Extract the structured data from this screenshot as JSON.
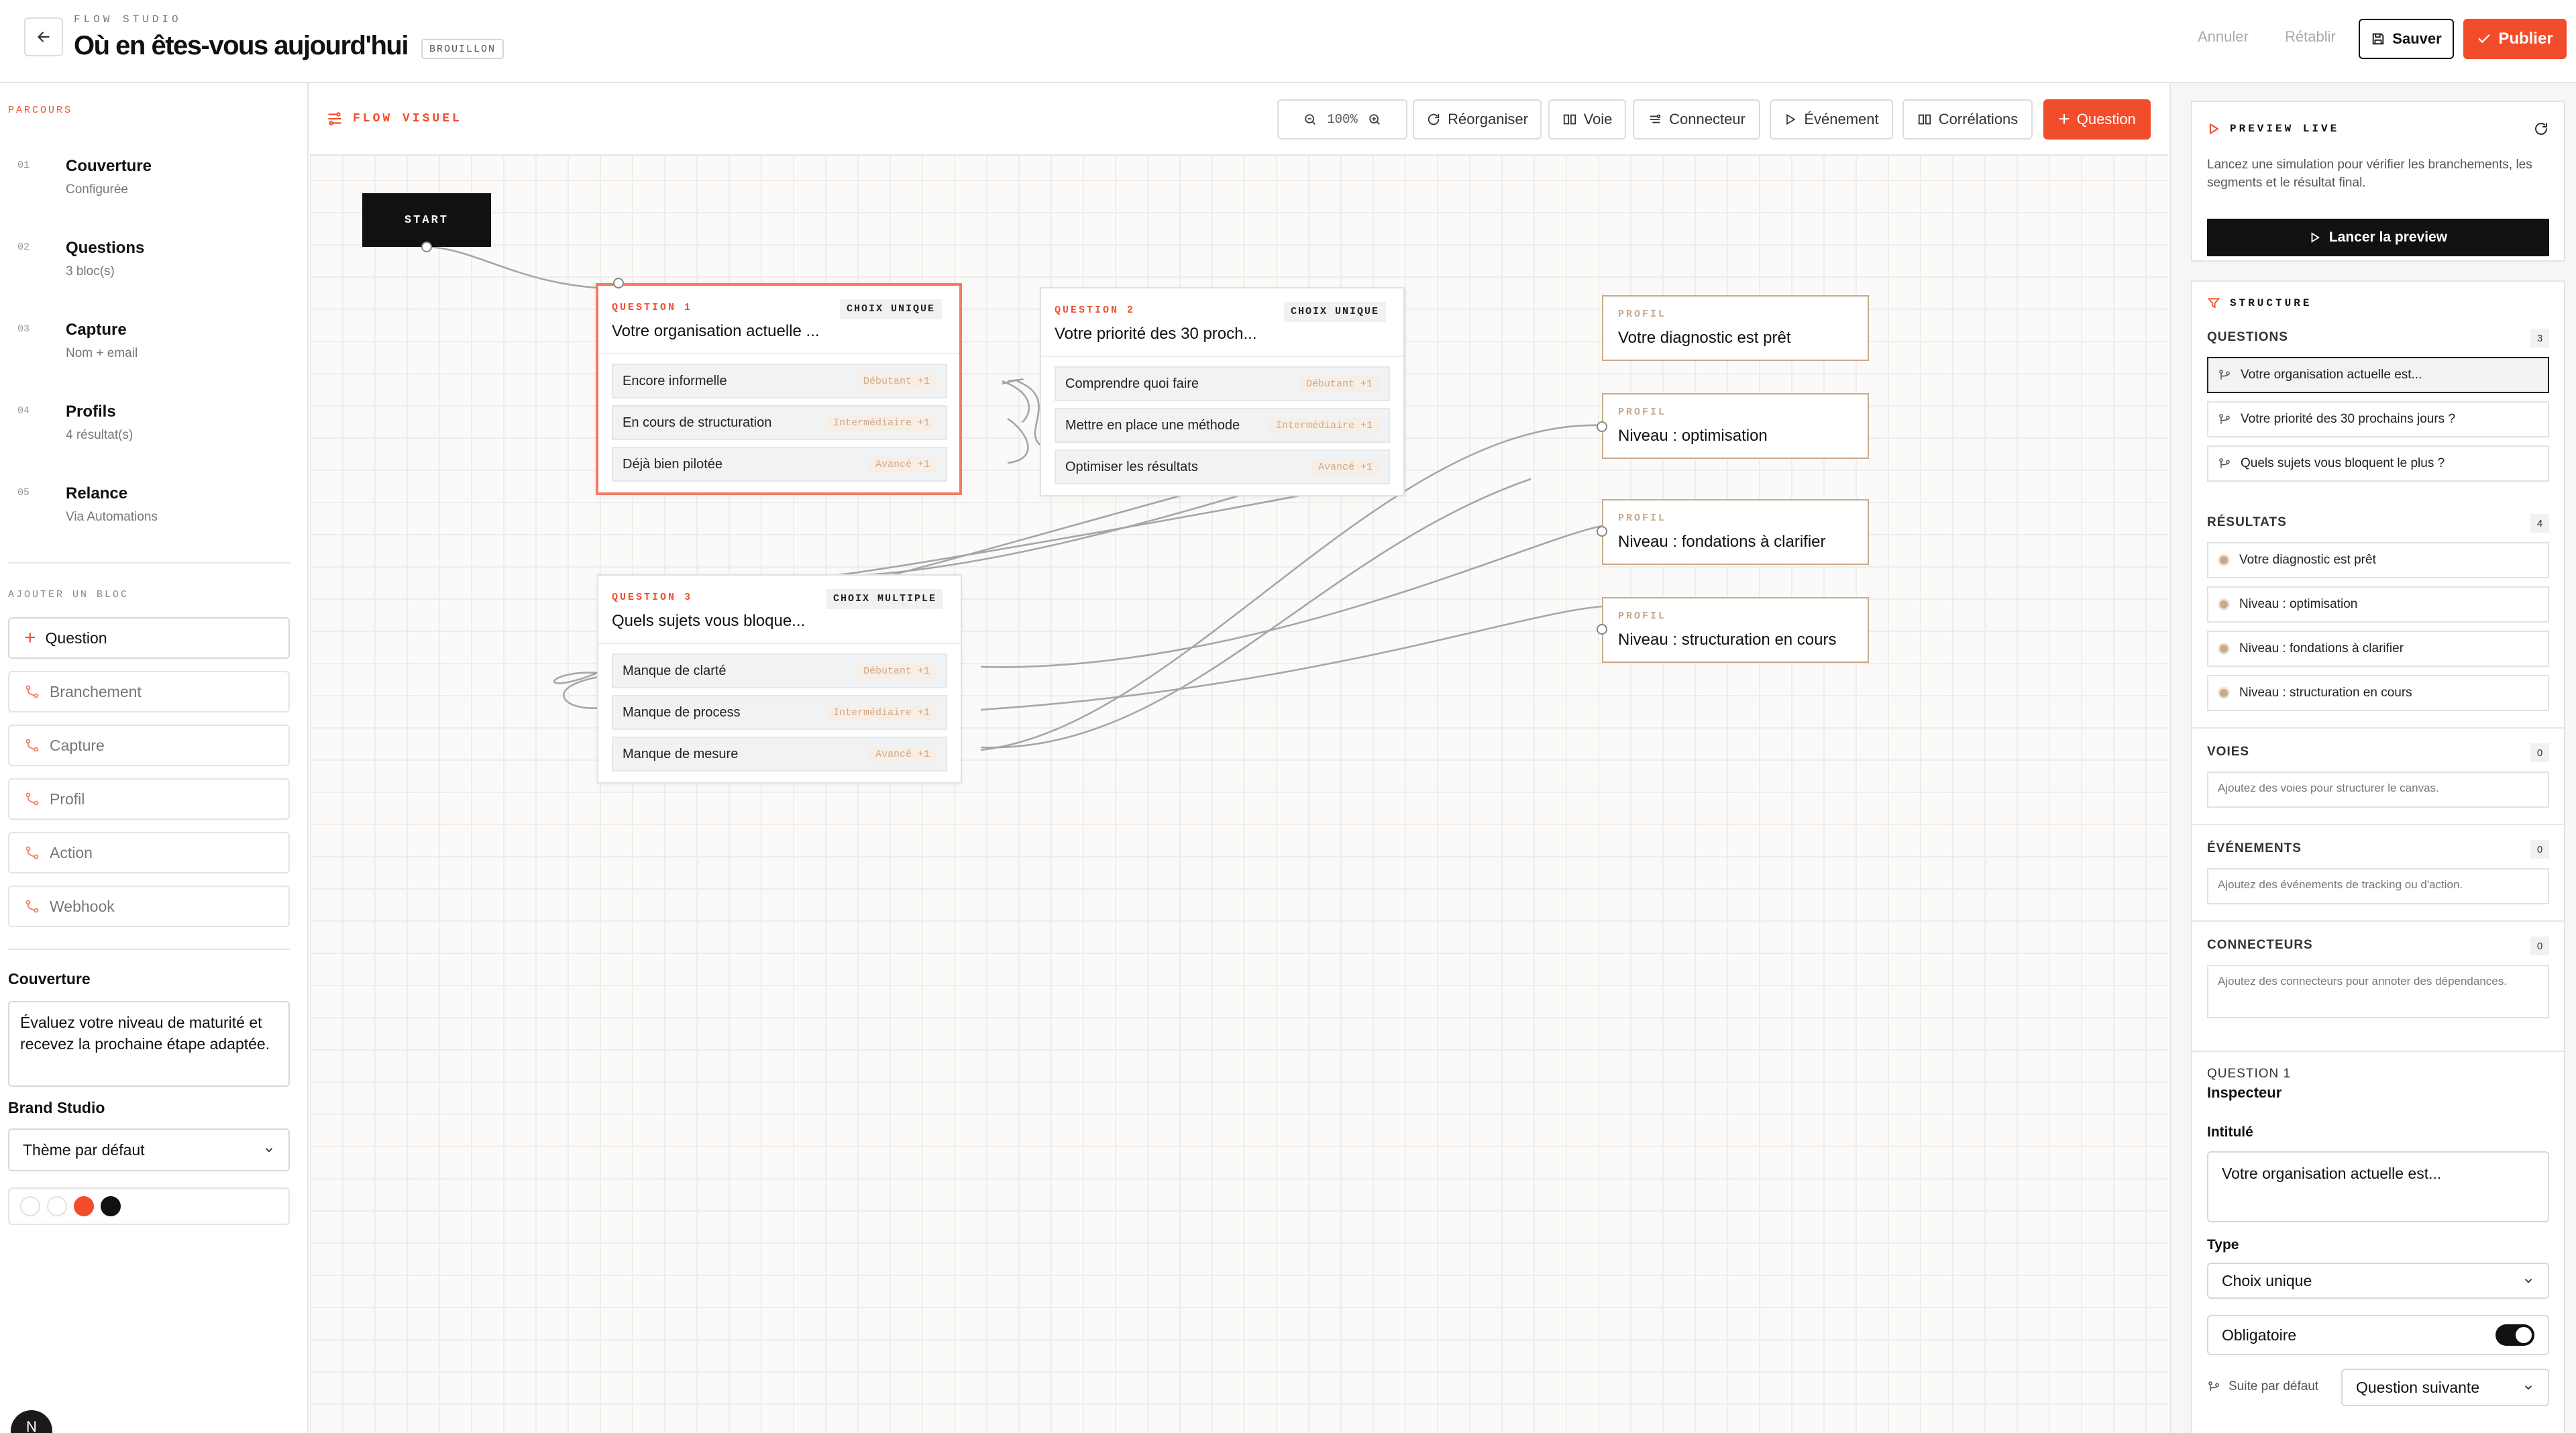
{
  "header": {
    "eyebrow": "FLOW STUDIO",
    "title": "Où en êtes-vous aujourd'hui",
    "status_badge": "BROUILLON",
    "undo_label": "Annuler",
    "redo_label": "Rétablir",
    "save_label": "Sauver",
    "publish_label": "Publier"
  },
  "sidebar": {
    "parcours_label": "PARCOURS",
    "steps": [
      {
        "num": "01",
        "title": "Couverture",
        "sub": "Configurée"
      },
      {
        "num": "02",
        "title": "Questions",
        "sub": "3 bloc(s)"
      },
      {
        "num": "03",
        "title": "Capture",
        "sub": "Nom + email"
      },
      {
        "num": "04",
        "title": "Profils",
        "sub": "4 résultat(s)"
      },
      {
        "num": "05",
        "title": "Relance",
        "sub": "Via Automations"
      }
    ],
    "add_block_label": "AJOUTER UN BLOC",
    "add_buttons": [
      "Question",
      "Branchement",
      "Capture",
      "Profil",
      "Action",
      "Webhook"
    ],
    "cover_heading": "Couverture",
    "cover_text": "Évaluez votre niveau de maturité et recevez la prochaine étape adaptée.",
    "brand_heading": "Brand Studio",
    "brand_theme": "Thème par défaut",
    "swatch_colors": [
      "#ffffff",
      "#ffffff",
      "#f24d2b",
      "#111111"
    ],
    "avatar_initial": "N"
  },
  "canvas": {
    "label": "FLOW VISUEL",
    "zoom": "100%",
    "toolbar": {
      "reorganize": "Réorganiser",
      "lane": "Voie",
      "connector": "Connecteur",
      "event": "Événement",
      "correlations": "Corrélations",
      "question": "Question"
    },
    "start_label": "START",
    "questions": [
      {
        "eyebrow": "QUESTION 1",
        "type": "CHOIX UNIQUE",
        "title": "Votre organisation actuelle ...",
        "options": [
          {
            "label": "Encore informelle",
            "tag": "Débutant +1"
          },
          {
            "label": "En cours de structuration",
            "tag": "Intermédiaire +1"
          },
          {
            "label": "Déjà bien pilotée",
            "tag": "Avancé +1"
          }
        ]
      },
      {
        "eyebrow": "QUESTION 2",
        "type": "CHOIX UNIQUE",
        "title": "Votre priorité des 30 proch...",
        "options": [
          {
            "label": "Comprendre quoi faire",
            "tag": "Débutant +1"
          },
          {
            "label": "Mettre en place une méthode",
            "tag": "Intermédiaire +1"
          },
          {
            "label": "Optimiser les résultats",
            "tag": "Avancé +1"
          }
        ]
      },
      {
        "eyebrow": "QUESTION 3",
        "type": "CHOIX MULTIPLE",
        "title": "Quels sujets vous bloque...",
        "options": [
          {
            "label": "Manque de clarté",
            "tag": "Débutant +1"
          },
          {
            "label": "Manque de process",
            "tag": "Intermédiaire +1"
          },
          {
            "label": "Manque de mesure",
            "tag": "Avancé +1"
          }
        ]
      }
    ],
    "profiles": [
      {
        "eyebrow": "PROFIL",
        "title": "Votre diagnostic est prêt"
      },
      {
        "eyebrow": "PROFIL",
        "title": "Niveau : optimisation"
      },
      {
        "eyebrow": "PROFIL",
        "title": "Niveau : fondations à clarifier"
      },
      {
        "eyebrow": "PROFIL",
        "title": "Niveau : structuration en cours"
      }
    ]
  },
  "right_panel": {
    "preview": {
      "title": "PREVIEW LIVE",
      "desc": "Lancez une simulation pour vérifier les branchements, les segments et le résultat final.",
      "button": "Lancer la preview"
    },
    "structure": {
      "title": "STRUCTURE",
      "questions_label": "QUESTIONS",
      "questions_count": "3",
      "questions": [
        "Votre organisation actuelle est...",
        "Votre priorité des 30 prochains jours ?",
        "Quels sujets vous bloquent le plus ?"
      ],
      "results_label": "RÉSULTATS",
      "results_count": "4",
      "results": [
        "Votre diagnostic est prêt",
        "Niveau : optimisation",
        "Niveau : fondations à clarifier",
        "Niveau : structuration en cours"
      ],
      "lanes_label": "VOIES",
      "lanes_count": "0",
      "lanes_empty": "Ajoutez des voies pour structurer le canvas.",
      "events_label": "ÉVÉNEMENTS",
      "events_count": "0",
      "events_empty": "Ajoutez des événements de tracking ou d'action.",
      "connectors_label": "CONNECTEURS",
      "connectors_count": "0",
      "connectors_empty": "Ajoutez des connecteurs pour annoter des dépendances."
    },
    "inspector": {
      "eyebrow": "QUESTION 1",
      "title": "Inspecteur",
      "label_field": "Intitulé",
      "label_value": "Votre organisation actuelle est...",
      "type_field": "Type",
      "type_value": "Choix unique",
      "required_label": "Obligatoire",
      "next_label": "Suite par défaut",
      "next_value": "Question suivante"
    }
  },
  "colors": {
    "accent": "#f24d2b",
    "profile": "#c8a98a",
    "dark": "#111111"
  }
}
